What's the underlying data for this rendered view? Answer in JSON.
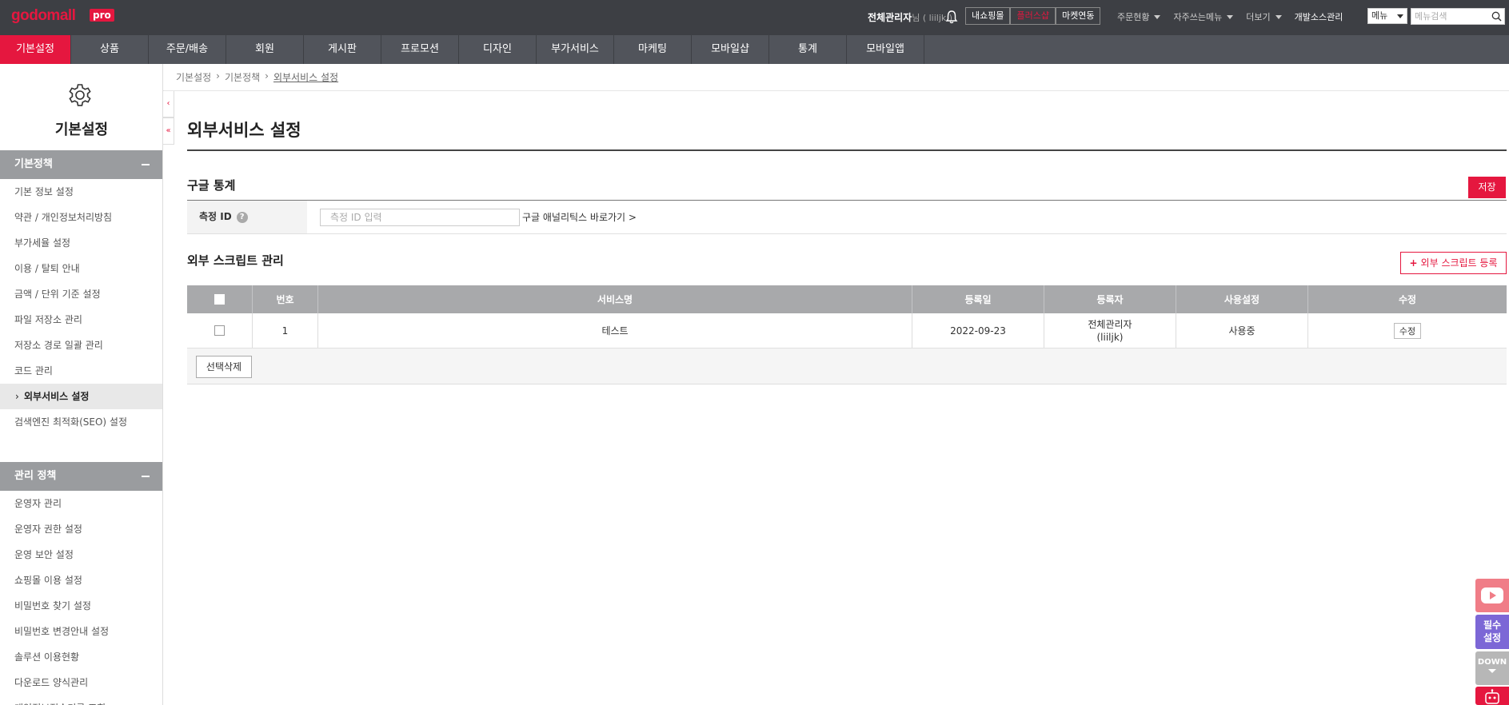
{
  "topbar": {
    "logo": "godomall",
    "logo_badge": "pro",
    "admin_name": "전체관리자",
    "admin_suffix": "님 ( liiljk )",
    "shop_buttons": [
      "내쇼핑몰",
      "플러스샵",
      "마켓연동"
    ],
    "menus": [
      "주문현황",
      "자주쓰는메뉴",
      "더보기",
      "개발소스관리"
    ],
    "menu_select": "메뉴",
    "search_placeholder": "메뉴검색"
  },
  "nav": [
    "기본설정",
    "상품",
    "주문/배송",
    "회원",
    "게시판",
    "프로모션",
    "디자인",
    "부가서비스",
    "마케팅",
    "모바일샵",
    "통계",
    "모바일앱"
  ],
  "sidebar": {
    "title": "기본설정",
    "section1": {
      "title": "기본정책",
      "items": [
        "기본 정보 설정",
        "약관 / 개인정보처리방침",
        "부가세율 설정",
        "이용 / 탈퇴 안내",
        "금액 / 단위 기준 설정",
        "파일 저장소 관리",
        "저장소 경로 일괄 관리",
        "코드 관리",
        "외부서비스 설정",
        "검색엔진 최적화(SEO) 설정"
      ]
    },
    "section2": {
      "title": "관리 정책",
      "items": [
        "운영자 관리",
        "운영자 권한 설정",
        "운영 보안 설정",
        "쇼핑몰 이용 설정",
        "비밀번호 찾기 설정",
        "비밀번호 변경안내 설정",
        "솔루션 이용현황",
        "다운로드 양식관리",
        "개인정보접속기록 조회"
      ]
    }
  },
  "breadcrumb": [
    "기본설정",
    "기본정책",
    "외부서비스 설정"
  ],
  "page_title": "외부서비스 설정",
  "google": {
    "title": "구글 통계",
    "save": "저장",
    "label": "측정 ID",
    "help": "?",
    "placeholder": "측정 ID 입력",
    "link": "구글 애널리틱스 바로가기 >"
  },
  "scripts": {
    "title": "외부 스크립트 관리",
    "add_button": "외부 스크립트 등록",
    "headers": [
      "번호",
      "서비스명",
      "등록일",
      "등록자",
      "사용설정",
      "수정"
    ],
    "rows": [
      {
        "no": "1",
        "name": "테스트",
        "date": "2022-09-23",
        "author": "전체관리자",
        "author_id": "(liiljk)",
        "status": "사용중",
        "edit": "수정"
      }
    ],
    "delete_button": "선택삭제"
  },
  "floating": {
    "required": "필수",
    "required2": "설정",
    "down": "DOWN"
  }
}
